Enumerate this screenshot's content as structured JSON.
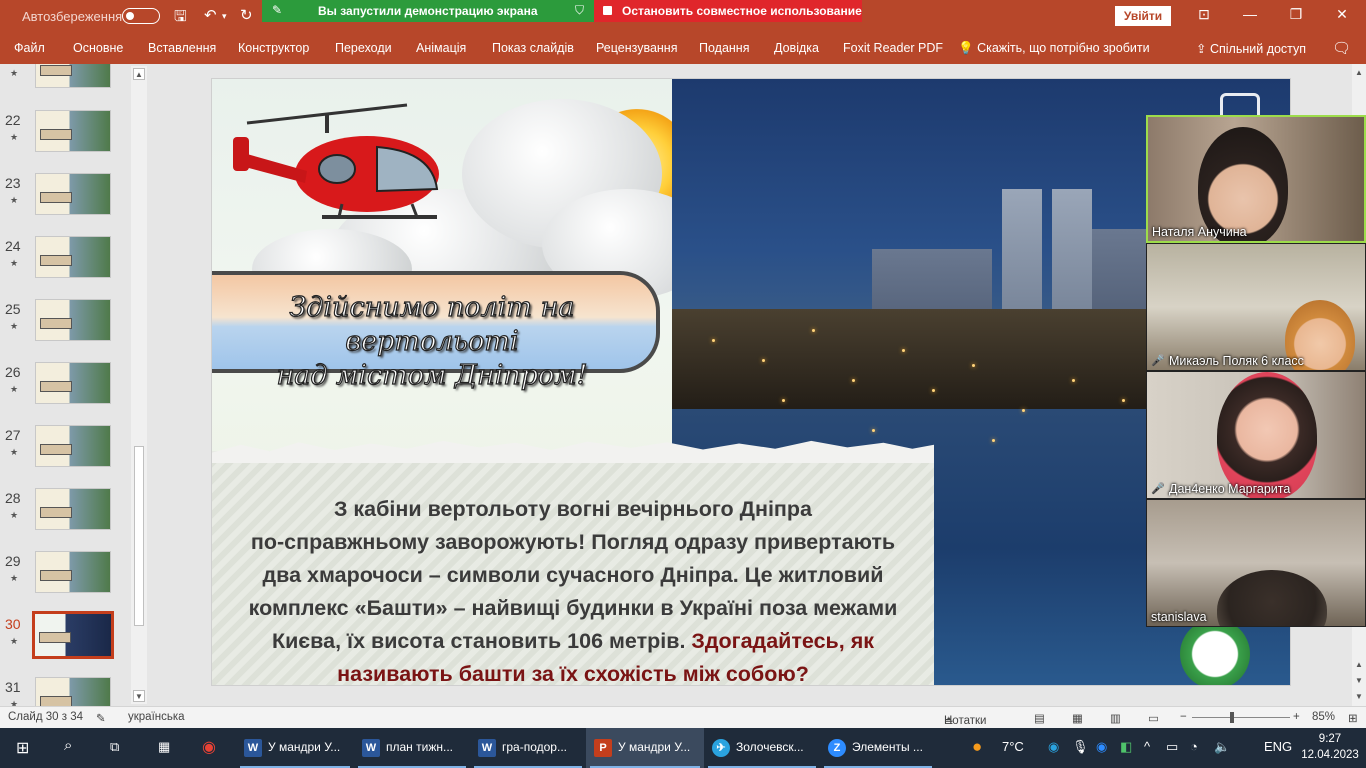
{
  "titlebar": {
    "autosave_label": "Автозбереження",
    "share_status": "Вы запустили демонстрацию экрана",
    "stop_share": "Остановить совместное использование",
    "signin": "Увійти"
  },
  "ribbon": {
    "tabs": [
      "Файл",
      "Основне",
      "Вставлення",
      "Конструктор",
      "Переходи",
      "Анімація",
      "Показ слайдів",
      "Рецензування",
      "Подання",
      "Довідка",
      "Foxit Reader PDF"
    ],
    "tell_me": "Скажіть, що потрібно зробити",
    "share": "Спільний доступ"
  },
  "thumbnails": [
    {
      "num": "",
      "star": "★"
    },
    {
      "num": "22",
      "star": "★"
    },
    {
      "num": "23",
      "star": "★"
    },
    {
      "num": "24",
      "star": "★"
    },
    {
      "num": "25",
      "star": "★"
    },
    {
      "num": "26",
      "star": "★"
    },
    {
      "num": "27",
      "star": "★"
    },
    {
      "num": "28",
      "star": "★"
    },
    {
      "num": "29",
      "star": "★"
    },
    {
      "num": "30",
      "star": "★"
    },
    {
      "num": "31",
      "star": "★"
    }
  ],
  "slide": {
    "title_line1": "Здійснимо політ на вертольоті",
    "title_line2": "над містом Дніпром!",
    "body_lines": [
      "З кабіни вертольоту вогні вечірнього Дніпра",
      "по-справжньому заворожують! Погляд одразу привертають",
      "два хмарочоси – символи сучасного Дніпра. Це житловий",
      "комплекс «Башти» – найвищі будинки в Україні поза межами"
    ],
    "body_line5_a": "Києва, їх висота становить 106 метрів. ",
    "body_line5_b": "Здогадайтесь, як",
    "body_line6": "називають башти за їх схожість між собою?"
  },
  "participants": [
    {
      "name": "Наталя Анучина",
      "muted": false,
      "active": true
    },
    {
      "name": "Микаэль Поляк 6 класс",
      "muted": true,
      "active": false
    },
    {
      "name": "Дан4енко Маргарита",
      "muted": true,
      "active": false
    },
    {
      "name": "stanislava",
      "muted": false,
      "active": false
    }
  ],
  "statusbar": {
    "slide_info": "Слайд 30 з 34",
    "language": "українська",
    "notes": "Нотатки",
    "zoom": "85%"
  },
  "taskbar": {
    "items": [
      {
        "icon": "W",
        "label": "У мандри У...",
        "color": "#2b579a"
      },
      {
        "icon": "W",
        "label": "план тижн...",
        "color": "#2b579a"
      },
      {
        "icon": "W",
        "label": "гра-подор...",
        "color": "#2b579a"
      },
      {
        "icon": "P",
        "label": "У мандри У...",
        "color": "#c43e1c"
      },
      {
        "icon": "✈",
        "label": "Золочевск...",
        "color": "#2aa3df"
      },
      {
        "icon": "Z",
        "label": "Элементы ...",
        "color": "#2d8cff"
      }
    ],
    "weather": "7°C",
    "lang": "ENG",
    "time": "9:27",
    "date": "12.04.2023"
  },
  "colors": {
    "accent": "#b7472a",
    "share_green": "#2c9b3c",
    "share_red": "#e0262b",
    "question_text": "#7a1414"
  }
}
